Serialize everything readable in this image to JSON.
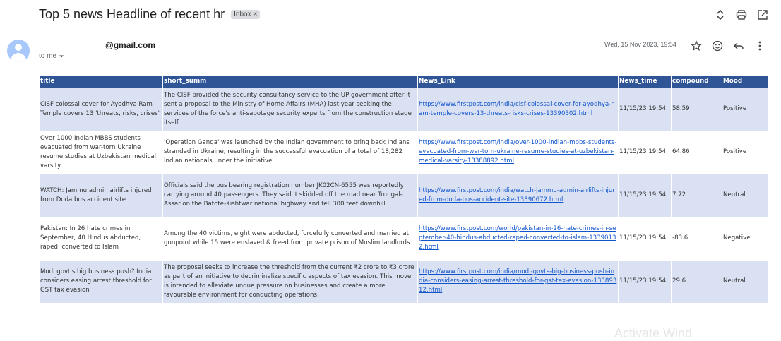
{
  "email": {
    "subject": "Top 5 news Headline of recent hr",
    "label": "Inbox",
    "label_close": "×",
    "sender": "@gmail.com",
    "recipient": "to me",
    "date": "Wed, 15 Nov 2023, 19:54"
  },
  "table": {
    "headers": [
      "title",
      "short_summ",
      "News_Link",
      "News_time",
      "compound",
      "Mood"
    ],
    "rows": [
      {
        "title": "CISF colossal cover for Ayodhya Ram Temple covers 13 'threats, risks, crises'",
        "short_summ": "The CISF provided the security consultancy service to the UP government after it sent a proposal to the Ministry of Home Affairs (MHA) last year seeking the services of the force's anti-sabotage security experts from the construction stage itself.",
        "link": "https://www.firstpost.com/india/cisf-colossal-cover-for-ayodhya-ram-temple-covers-13-threats-risks-crises-13390302.html",
        "time": "11/15/23 19:54",
        "compound": "58.59",
        "mood": "Positive"
      },
      {
        "title": "Over 1000 Indian MBBS students evacuated from war-torn Ukraine resume studies at Uzbekistan medical varsity",
        "short_summ": "'Operation Ganga' was launched by the Indian government to bring back Indians stranded in Ukraine, resulting in the successful evacuation of a total of 18,282 Indian nationals under the initiative.",
        "link": "https://www.firstpost.com/india/over-1000-indian-mbbs-students-evacuated-from-war-torn-ukraine-resume-studies-at-uzbekistan-medical-varsity-13388892.html",
        "time": "11/15/23 19:54",
        "compound": "64.86",
        "mood": "Positive"
      },
      {
        "title": "WATCH: Jammu admin airlifts injured from Doda bus accident site",
        "short_summ": "Officials said the bus bearing registration number JK02CN-6555 was reportedly carrying around 40 passengers. They said it skidded off the road near Trungal-Assar on the Batote-Kishtwar national highway and fell 300 feet downhill",
        "link": "https://www.firstpost.com/india/watch-jammu-admin-airlifts-injured-from-doda-bus-accident-site-13390672.html",
        "time": "11/15/23 19:54",
        "compound": "7.72",
        "mood": "Neutral"
      },
      {
        "title": "Pakistan: In 26 hate crimes in September, 40 Hindus abducted, raped, converted to Islam",
        "short_summ": "Among the 40 victims, eight were abducted, forcefully converted and married at gunpoint while 15 were enslaved & freed from private prison of Muslim landlords",
        "link": "https://www.firstpost.com/world/pakistan-in-26-hate-crimes-in-september-40-hindus-abducted-raped-converted-to-islam-13390132.html",
        "time": "11/15/23 19:54",
        "compound": "-83.6",
        "mood": "Negative"
      },
      {
        "title": "Modi govt's big business push? India considers easing arrest threshold for GST tax evasion",
        "short_summ": "The proposal seeks to increase the threshold from the current ₹2 crore to ₹3 crore as part of an initiative to decriminalize specific aspects of tax evasion. This move is intended to alleviate undue pressure on businesses and create a more favourable environment for conducting operations.",
        "link": "https://www.firstpost.com/india/modi-govts-big-business-push-india-considers-easing-arrest-threshold-for-gst-tax-evasion-13389312.html",
        "time": "11/15/23 19:54",
        "compound": "29.6",
        "mood": "Neutral"
      }
    ]
  },
  "colors": {
    "header_bg": "#2f5597",
    "row_alt_bg": "#d9e1f2",
    "link": "#1155cc"
  },
  "icons": [
    "expand-icon",
    "print-icon",
    "open-new-window-icon",
    "star-icon",
    "emoji-icon",
    "reply-icon",
    "more-vert-icon"
  ],
  "watermark": "Activate Wind"
}
